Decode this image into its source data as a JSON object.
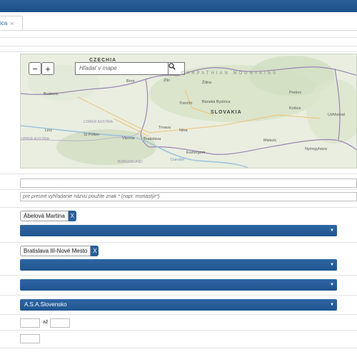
{
  "tab": {
    "label": "ica",
    "close": "×"
  },
  "map": {
    "search_placeholder": "Hľadať v mape",
    "zoom_out": "−",
    "zoom_in": "+",
    "labels": {
      "czechia": "CZECHIA",
      "carpathian": "CARPATHIAN MOUNTAINS",
      "slovakia": "SLOVAKIA",
      "budweis": "Budweis",
      "brno": "Brno",
      "zlin": "Zlín",
      "zilina": "Žilina",
      "trencin": "Trenčín",
      "banska": "Banská Bystrica",
      "presov": "Prešov",
      "kosice": "Košice",
      "uzhhorod": "Uzhhorod",
      "trnava": "Trnava",
      "nitra": "Nitra",
      "bratislava": "Bratislava",
      "vienna": "Vienna",
      "linz": "Linz",
      "stpolten": "St Pölten",
      "lower_austria": "LOWER AUSTRIA",
      "upper_austria": "UPPER AUSTRIA",
      "miskolc": "Miskolc",
      "nyiregyhaza": "Nyíregyháza",
      "esztergom": "Esztergom",
      "danube": "Danube",
      "burgenland": "BURGENLAND"
    }
  },
  "hint_text": "pre presné vyhľadanie názvu použite znak * (napr. monastýr*)",
  "chips": [
    {
      "label": "Ábelová Martina",
      "remove": "X"
    },
    {
      "label": "Bratislava III-Nové Mesto",
      "remove": "X"
    }
  ],
  "selects": [
    {
      "value": ""
    },
    {
      "value": ""
    },
    {
      "value": ""
    },
    {
      "value": "A.S.A.Slovensko"
    }
  ],
  "range_separator": "až",
  "colors": {
    "header": "#1b4f87",
    "select": "#245b97",
    "map_bg": "#e9eee0"
  }
}
